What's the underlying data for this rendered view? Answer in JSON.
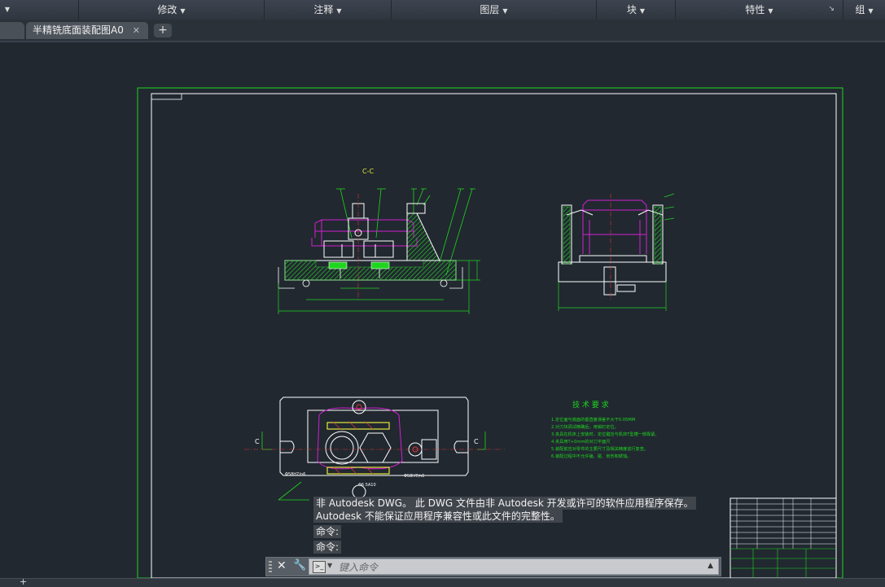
{
  "ribbon": {
    "panels": [
      {
        "label": "",
        "id": "first"
      },
      {
        "label": "修改",
        "id": "modify"
      },
      {
        "label": "注释",
        "id": "annotate"
      },
      {
        "label": "图层",
        "id": "layers"
      },
      {
        "label": "块",
        "id": "block"
      },
      {
        "label": "特性",
        "id": "properties"
      },
      {
        "label": "组",
        "id": "groups"
      }
    ],
    "expand_icon": "ribbon-expand-icon"
  },
  "tabs": {
    "active": "半精铣底面装配图A0",
    "close_icon": "close-icon",
    "new_tab_label": "+"
  },
  "drawing": {
    "section_label": "C-C",
    "tech_title": "技 术 要 求",
    "tech_notes": [
      "1.定位面与底面的垂直度误差不大于0.05MM",
      "2.对刀块调试精确后，用销钉定位。",
      "3.夹具在机床上安装时，定位键应与机床T型槽一侧靠紧。",
      "4.夹具用T+0mm的对刀平面尺",
      "5.装配前应对零件的主要尺寸及相关精度进行复查。",
      "6.装配过程中不允许磕、碰、划伤和锈蚀。"
    ],
    "label_c_left": "C",
    "label_c_right": "C",
    "dim_fit_1": "Φ58H7/n6",
    "dim_fit_2": "Φ58H7/n6",
    "dim_fit_3": "Φ6.5A10"
  },
  "command": {
    "warning_line1": "非 Autodesk DWG。 此 DWG 文件由非 Autodesk 开发或许可的软件应用程序保存。",
    "warning_line2": "Autodesk 不能保证应用程序兼容性或此文件的完整性。",
    "history": [
      "命令:",
      "命令:"
    ],
    "placeholder": "键入命令"
  },
  "colors": {
    "background": "#212830",
    "frame": "#1fd61f",
    "outline": "#ffffff",
    "magenta": "#d11fd1",
    "hatch": "#26c526",
    "yellow": "#e6e63a",
    "center": "#e03535"
  }
}
